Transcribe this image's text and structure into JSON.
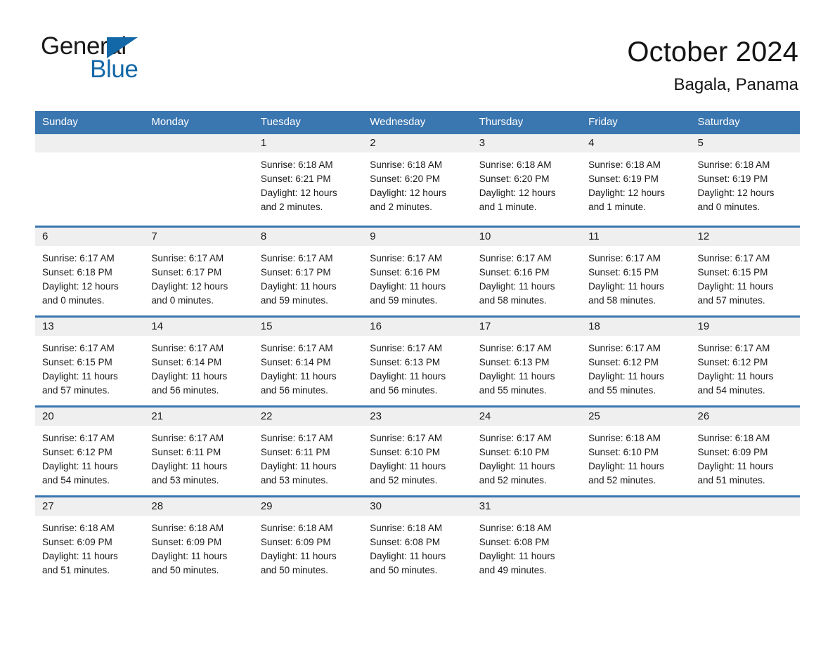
{
  "brand": {
    "name_part1": "General",
    "name_part2": "Blue",
    "logo_icon": "triangle-icon"
  },
  "header": {
    "month_title": "October 2024",
    "location": "Bagala, Panama"
  },
  "colors": {
    "header_blue": "#3a76b0",
    "brand_blue": "#1368a8",
    "day_band_gray": "#efefef",
    "text": "#1a1a1a"
  },
  "weekday_headers": [
    "Sunday",
    "Monday",
    "Tuesday",
    "Wednesday",
    "Thursday",
    "Friday",
    "Saturday"
  ],
  "weeks": [
    [
      {
        "day": "",
        "lines": []
      },
      {
        "day": "",
        "lines": []
      },
      {
        "day": "1",
        "lines": [
          "Sunrise: 6:18 AM",
          "Sunset: 6:21 PM",
          "Daylight: 12 hours",
          "and 2 minutes."
        ]
      },
      {
        "day": "2",
        "lines": [
          "Sunrise: 6:18 AM",
          "Sunset: 6:20 PM",
          "Daylight: 12 hours",
          "and 2 minutes."
        ]
      },
      {
        "day": "3",
        "lines": [
          "Sunrise: 6:18 AM",
          "Sunset: 6:20 PM",
          "Daylight: 12 hours",
          "and 1 minute."
        ]
      },
      {
        "day": "4",
        "lines": [
          "Sunrise: 6:18 AM",
          "Sunset: 6:19 PM",
          "Daylight: 12 hours",
          "and 1 minute."
        ]
      },
      {
        "day": "5",
        "lines": [
          "Sunrise: 6:18 AM",
          "Sunset: 6:19 PM",
          "Daylight: 12 hours",
          "and 0 minutes."
        ]
      }
    ],
    [
      {
        "day": "6",
        "lines": [
          "Sunrise: 6:17 AM",
          "Sunset: 6:18 PM",
          "Daylight: 12 hours",
          "and 0 minutes."
        ]
      },
      {
        "day": "7",
        "lines": [
          "Sunrise: 6:17 AM",
          "Sunset: 6:17 PM",
          "Daylight: 12 hours",
          "and 0 minutes."
        ]
      },
      {
        "day": "8",
        "lines": [
          "Sunrise: 6:17 AM",
          "Sunset: 6:17 PM",
          "Daylight: 11 hours",
          "and 59 minutes."
        ]
      },
      {
        "day": "9",
        "lines": [
          "Sunrise: 6:17 AM",
          "Sunset: 6:16 PM",
          "Daylight: 11 hours",
          "and 59 minutes."
        ]
      },
      {
        "day": "10",
        "lines": [
          "Sunrise: 6:17 AM",
          "Sunset: 6:16 PM",
          "Daylight: 11 hours",
          "and 58 minutes."
        ]
      },
      {
        "day": "11",
        "lines": [
          "Sunrise: 6:17 AM",
          "Sunset: 6:15 PM",
          "Daylight: 11 hours",
          "and 58 minutes."
        ]
      },
      {
        "day": "12",
        "lines": [
          "Sunrise: 6:17 AM",
          "Sunset: 6:15 PM",
          "Daylight: 11 hours",
          "and 57 minutes."
        ]
      }
    ],
    [
      {
        "day": "13",
        "lines": [
          "Sunrise: 6:17 AM",
          "Sunset: 6:15 PM",
          "Daylight: 11 hours",
          "and 57 minutes."
        ]
      },
      {
        "day": "14",
        "lines": [
          "Sunrise: 6:17 AM",
          "Sunset: 6:14 PM",
          "Daylight: 11 hours",
          "and 56 minutes."
        ]
      },
      {
        "day": "15",
        "lines": [
          "Sunrise: 6:17 AM",
          "Sunset: 6:14 PM",
          "Daylight: 11 hours",
          "and 56 minutes."
        ]
      },
      {
        "day": "16",
        "lines": [
          "Sunrise: 6:17 AM",
          "Sunset: 6:13 PM",
          "Daylight: 11 hours",
          "and 56 minutes."
        ]
      },
      {
        "day": "17",
        "lines": [
          "Sunrise: 6:17 AM",
          "Sunset: 6:13 PM",
          "Daylight: 11 hours",
          "and 55 minutes."
        ]
      },
      {
        "day": "18",
        "lines": [
          "Sunrise: 6:17 AM",
          "Sunset: 6:12 PM",
          "Daylight: 11 hours",
          "and 55 minutes."
        ]
      },
      {
        "day": "19",
        "lines": [
          "Sunrise: 6:17 AM",
          "Sunset: 6:12 PM",
          "Daylight: 11 hours",
          "and 54 minutes."
        ]
      }
    ],
    [
      {
        "day": "20",
        "lines": [
          "Sunrise: 6:17 AM",
          "Sunset: 6:12 PM",
          "Daylight: 11 hours",
          "and 54 minutes."
        ]
      },
      {
        "day": "21",
        "lines": [
          "Sunrise: 6:17 AM",
          "Sunset: 6:11 PM",
          "Daylight: 11 hours",
          "and 53 minutes."
        ]
      },
      {
        "day": "22",
        "lines": [
          "Sunrise: 6:17 AM",
          "Sunset: 6:11 PM",
          "Daylight: 11 hours",
          "and 53 minutes."
        ]
      },
      {
        "day": "23",
        "lines": [
          "Sunrise: 6:17 AM",
          "Sunset: 6:10 PM",
          "Daylight: 11 hours",
          "and 52 minutes."
        ]
      },
      {
        "day": "24",
        "lines": [
          "Sunrise: 6:17 AM",
          "Sunset: 6:10 PM",
          "Daylight: 11 hours",
          "and 52 minutes."
        ]
      },
      {
        "day": "25",
        "lines": [
          "Sunrise: 6:18 AM",
          "Sunset: 6:10 PM",
          "Daylight: 11 hours",
          "and 52 minutes."
        ]
      },
      {
        "day": "26",
        "lines": [
          "Sunrise: 6:18 AM",
          "Sunset: 6:09 PM",
          "Daylight: 11 hours",
          "and 51 minutes."
        ]
      }
    ],
    [
      {
        "day": "27",
        "lines": [
          "Sunrise: 6:18 AM",
          "Sunset: 6:09 PM",
          "Daylight: 11 hours",
          "and 51 minutes."
        ]
      },
      {
        "day": "28",
        "lines": [
          "Sunrise: 6:18 AM",
          "Sunset: 6:09 PM",
          "Daylight: 11 hours",
          "and 50 minutes."
        ]
      },
      {
        "day": "29",
        "lines": [
          "Sunrise: 6:18 AM",
          "Sunset: 6:09 PM",
          "Daylight: 11 hours",
          "and 50 minutes."
        ]
      },
      {
        "day": "30",
        "lines": [
          "Sunrise: 6:18 AM",
          "Sunset: 6:08 PM",
          "Daylight: 11 hours",
          "and 50 minutes."
        ]
      },
      {
        "day": "31",
        "lines": [
          "Sunrise: 6:18 AM",
          "Sunset: 6:08 PM",
          "Daylight: 11 hours",
          "and 49 minutes."
        ]
      },
      {
        "day": "",
        "lines": []
      },
      {
        "day": "",
        "lines": []
      }
    ]
  ]
}
